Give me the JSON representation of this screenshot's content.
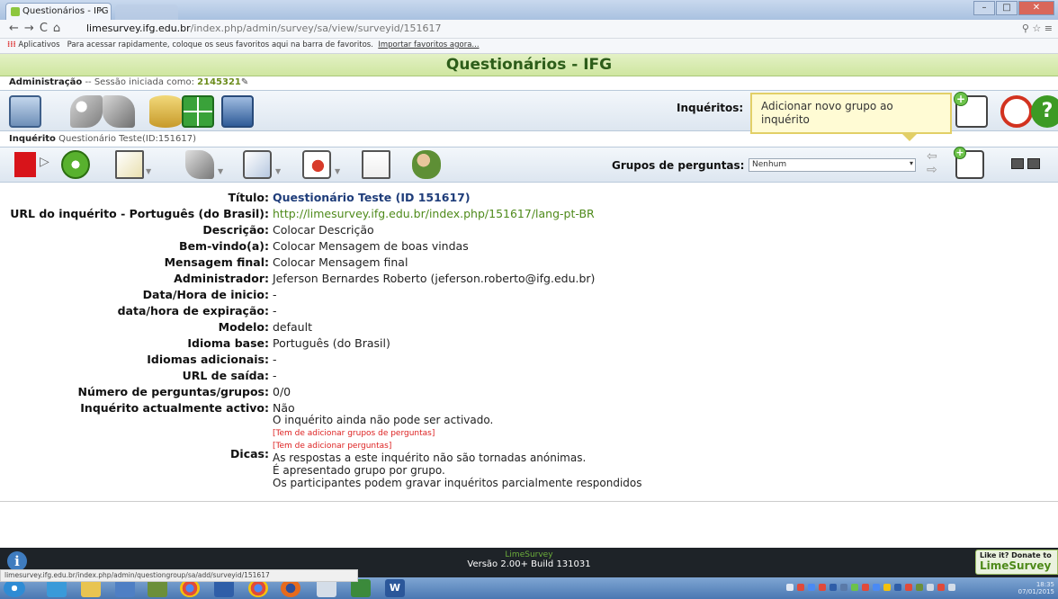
{
  "browser": {
    "tab_title": "Questionários - IFG",
    "tab_close": "×",
    "url_host": "limesurvey.ifg.edu.br",
    "url_path": "/index.php/admin/survey/sa/view/surveyid/151617",
    "bookmarks_apps": "Aplicativos",
    "bookmarks_hint": "Para acessar rapidamente, coloque os seus favoritos aqui na barra de favoritos.",
    "bookmarks_import": "Importar favoritos agora...",
    "status_url": "limesurvey.ifg.edu.br/index.php/admin/questiongroup/sa/add/surveyid/151617"
  },
  "app": {
    "title": "Questionários - IFG",
    "admin_label": "Administração",
    "session_text": "-- Sessão iniciada como:",
    "session_user": "2145321"
  },
  "toolbar1": {
    "inqueritos_label": "Inquéritos:",
    "tooltip": "Adicionar novo grupo ao inquérito"
  },
  "survey_bar": {
    "label": "Inquérito",
    "name": "Questionário Teste(ID:151617)"
  },
  "toolbar2": {
    "groups_label": "Grupos de perguntas:",
    "groups_selected": "Nenhum"
  },
  "details": [
    {
      "label": "Título:",
      "value": "Questionário Teste (ID 151617)"
    },
    {
      "label": "URL do inquérito - Português (do Brasil):",
      "value": "http://limesurvey.ifg.edu.br/index.php/151617/lang-pt-BR"
    },
    {
      "label": "Descrição:",
      "value": "Colocar Descrição"
    },
    {
      "label": "Bem-vindo(a):",
      "value": "Colocar Mensagem de boas vindas"
    },
    {
      "label": "Mensagem final:",
      "value": "Colocar Mensagem final"
    },
    {
      "label": "Administrador:",
      "value": "Jeferson Bernardes Roberto (jeferson.roberto@ifg.edu.br)"
    },
    {
      "label": "Data/Hora de inicio:",
      "value": "-"
    },
    {
      "label": "data/hora de expiração:",
      "value": "-"
    },
    {
      "label": "Modelo:",
      "value": "default"
    },
    {
      "label": "Idioma base:",
      "value": "Português (do Brasil)"
    },
    {
      "label": "Idiomas adicionais:",
      "value": "-"
    },
    {
      "label": "URL de saída:",
      "value": "-"
    },
    {
      "label": "Número de perguntas/grupos:",
      "value": "0/0"
    },
    {
      "label": "Inquérito actualmente activo:",
      "value": "Não"
    }
  ],
  "tips": {
    "label": "Dicas:",
    "line1": "O inquérito ainda não pode ser activado.",
    "warn1": "[Tem de adicionar grupos de perguntas]",
    "warn2": "[Tem de adicionar perguntas]",
    "line2": "As respostas a este inquérito não são tornadas anónimas.",
    "line3": "É apresentado grupo por grupo.",
    "line4": "Os participantes podem gravar inquéritos parcialmente respondidos"
  },
  "footer": {
    "brand": "LimeSurvey",
    "version": "Versão 2.00+ Build 131031",
    "donate_line1": "Like it? Donate to",
    "donate_line2": "LimeSurvey"
  },
  "taskbar": {
    "clock_time": "18:35",
    "clock_date": "07/01/2015"
  }
}
